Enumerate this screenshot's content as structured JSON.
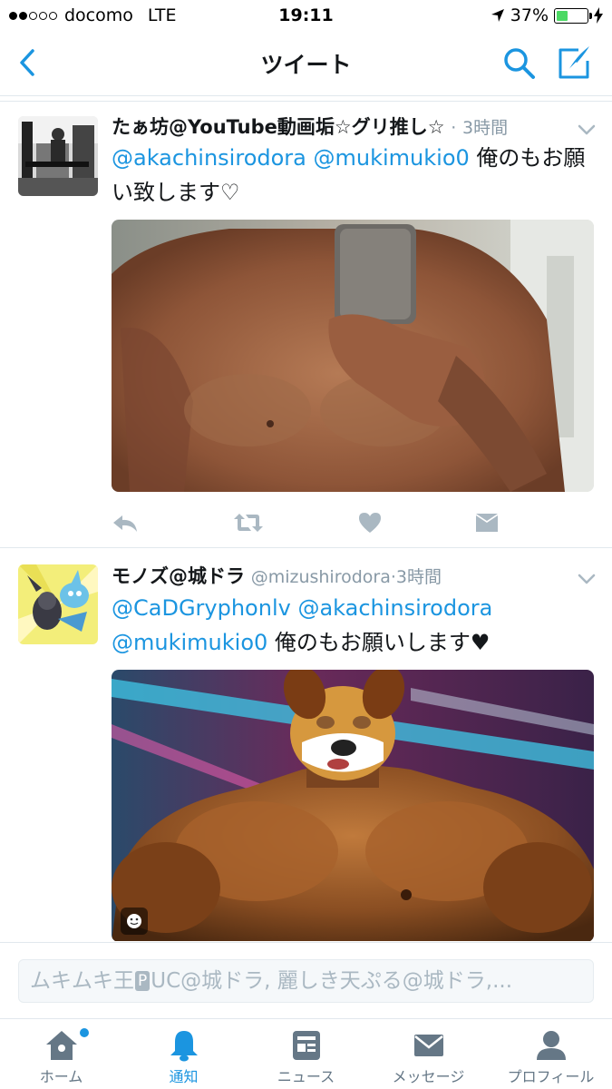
{
  "status_bar": {
    "carrier": "docomo",
    "network": "LTE",
    "time": "19:11",
    "battery_pct": "37%",
    "battery_level": 0.37,
    "signal_bars_filled": 2,
    "signal_bars_total": 5
  },
  "nav": {
    "title": "ツイート",
    "back_icon": "chevron-left-icon",
    "search_icon": "search-icon",
    "compose_icon": "compose-tweet-icon"
  },
  "tweets": [
    {
      "name": "たぁ坊@YouTube動画垢☆グリ推し☆",
      "handle": "",
      "dot": "·",
      "time": "3時間",
      "mentions": [
        "@akachinsirodora",
        "@mukimukio0"
      ],
      "text": "俺のもお願い致します♡",
      "media_description_icon": "photo",
      "actions": [
        "reply-icon",
        "retweet-icon",
        "like-icon",
        "direct-message-icon"
      ]
    },
    {
      "name": "モノズ@城ドラ",
      "handle": "@mizushirodora",
      "dot": "·",
      "time": "3時間",
      "mentions": [
        "@CaDGryphonlv",
        "@akachinsirodora",
        "@mukimukio0"
      ],
      "text": "俺のもお願いします♥",
      "media_description_icon": "photo",
      "sticker_icon": "smiley-icon"
    }
  ],
  "reply": {
    "prefix": "ムキムキ王",
    "badge": "P",
    "suffix": "UC@城ドラ, 麗しき天ぷる@城ドラ,..."
  },
  "tabs": [
    {
      "label": "ホーム",
      "icon": "home-icon",
      "active": false,
      "badge": true
    },
    {
      "label": "通知",
      "icon": "bell-icon",
      "active": true,
      "badge": false
    },
    {
      "label": "ニュース",
      "icon": "news-icon",
      "active": false,
      "badge": false
    },
    {
      "label": "メッセージ",
      "icon": "envelope-icon",
      "active": false,
      "badge": false
    },
    {
      "label": "プロフィール",
      "icon": "profile-icon",
      "active": false,
      "badge": false
    }
  ],
  "colors": {
    "accent": "#1b95e0",
    "muted": "#8899a6",
    "icon_gray": "#657786",
    "battery_green": "#4cd964"
  }
}
